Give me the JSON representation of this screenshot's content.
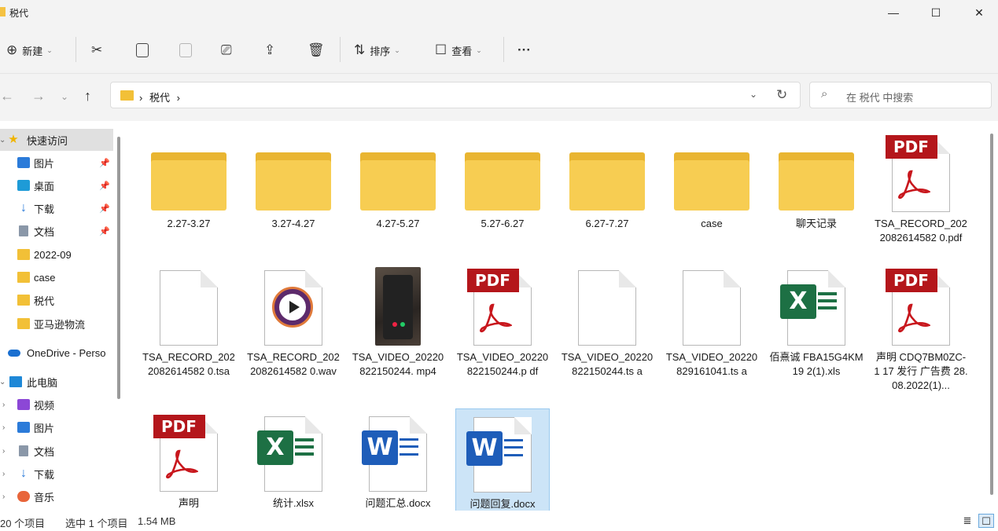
{
  "window": {
    "title": "税代",
    "minimize_glyph": "—",
    "maximize_glyph": "☐",
    "close_glyph": "✕"
  },
  "toolbar": {
    "new_label": "新建",
    "sort_label": "排序",
    "view_label": "查看",
    "more_label": "···",
    "icons": [
      "plus-circle-icon",
      "scissors-icon",
      "copy-icon",
      "paste-icon",
      "rename-icon",
      "share-icon",
      "delete-icon",
      "sort-icon",
      "view-icon"
    ]
  },
  "address": {
    "back": "←",
    "forward": "→",
    "recent": "⌄",
    "up": "↑",
    "crumb_sep": "›",
    "crumb": "税代",
    "dropdown": "⌄",
    "refresh": "↻"
  },
  "search": {
    "placeholder": "在 税代 中搜索"
  },
  "sidebar": {
    "items": [
      {
        "label": "快速访问",
        "icon": "star-icon"
      },
      {
        "label": "图片",
        "icon": "pictures-icon"
      },
      {
        "label": "桌面",
        "icon": "desktop-icon"
      },
      {
        "label": "下载",
        "icon": "download-icon"
      },
      {
        "label": "文档",
        "icon": "documents-icon"
      },
      {
        "label": "2022-09",
        "icon": "folder-icon"
      },
      {
        "label": "case",
        "icon": "folder-icon"
      },
      {
        "label": "税代",
        "icon": "folder-icon"
      },
      {
        "label": "亚马逊物流",
        "icon": "folder-icon"
      },
      {
        "label": "OneDrive - Perso",
        "icon": "cloud-icon"
      },
      {
        "label": "此电脑",
        "icon": "computer-icon"
      },
      {
        "label": "视频",
        "icon": "videos-icon"
      },
      {
        "label": "图片",
        "icon": "pictures-icon"
      },
      {
        "label": "文档",
        "icon": "documents-icon"
      },
      {
        "label": "下载",
        "icon": "download-icon"
      },
      {
        "label": "音乐",
        "icon": "music-icon"
      }
    ]
  },
  "files": [
    {
      "name": "2.27-3.27",
      "type": "folder"
    },
    {
      "name": "3.27-4.27",
      "type": "folder"
    },
    {
      "name": "4.27-5.27",
      "type": "folder"
    },
    {
      "name": "5.27-6.27",
      "type": "folder"
    },
    {
      "name": "6.27-7.27",
      "type": "folder"
    },
    {
      "name": "case",
      "type": "folder"
    },
    {
      "name": "聊天记录",
      "type": "folder"
    },
    {
      "name": "TSA_RECORD_2022082614582 0.pdf",
      "type": "pdf"
    },
    {
      "name": "TSA_RECORD_2022082614582 0.tsa",
      "type": "blank"
    },
    {
      "name": "TSA_RECORD_2022082614582 0.wav",
      "type": "wav"
    },
    {
      "name": "TSA_VIDEO_20220822150244. mp4",
      "type": "photo"
    },
    {
      "name": "TSA_VIDEO_20220822150244.p df",
      "type": "pdf"
    },
    {
      "name": "TSA_VIDEO_20220822150244.ts a",
      "type": "blank"
    },
    {
      "name": "TSA_VIDEO_20220829161041.ts a",
      "type": "blank"
    },
    {
      "name": "佰熹诚 FBA15G4KM19 2(1).xls",
      "type": "xls"
    },
    {
      "name": "声明 CDQ7BM0ZC-1 17 发行 广告费 28.08.2022(1)...",
      "type": "pdf"
    },
    {
      "name": "声明",
      "type": "pdf"
    },
    {
      "name": "统计.xlsx",
      "type": "xls"
    },
    {
      "name": "问题汇总.docx",
      "type": "docx"
    },
    {
      "name": "问题回复.docx",
      "type": "docx"
    }
  ],
  "pdf_badge": "PDF",
  "xls_badge": "X",
  "word_badge": "W",
  "status": {
    "count": "20 个项目",
    "selection": "选中 1 个项目",
    "size": "1.54 MB"
  },
  "colors": {
    "folder": "#f7cd52",
    "pdf": "#b4161b",
    "excel": "#1d7044",
    "word": "#1e5db9",
    "selection": "#cce4f7"
  }
}
